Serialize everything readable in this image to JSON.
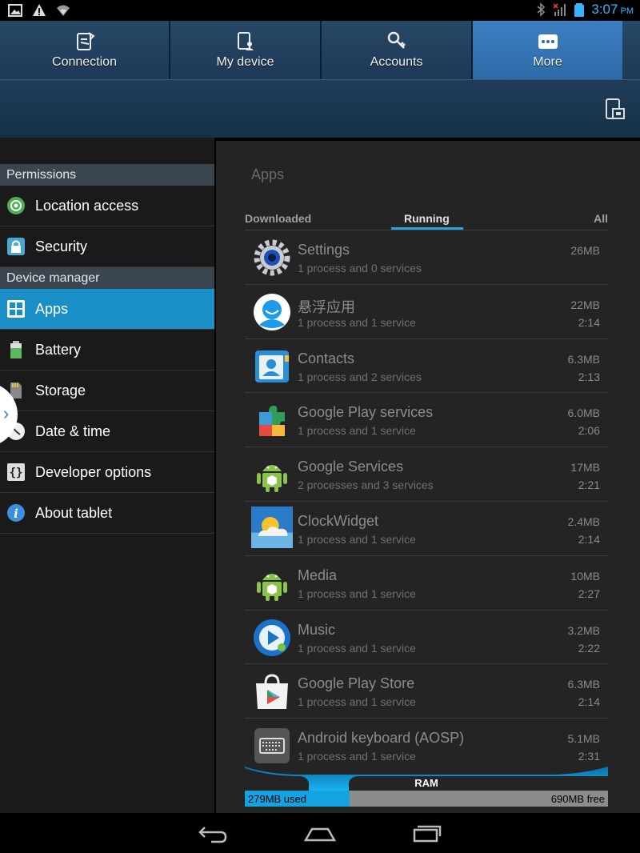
{
  "status": {
    "time": "3:07",
    "ampm": "PM"
  },
  "tabs": [
    {
      "label": "Connection",
      "icon": "connection-icon",
      "active": false
    },
    {
      "label": "My device",
      "icon": "device-icon",
      "active": false
    },
    {
      "label": "Accounts",
      "icon": "key-icon",
      "active": false
    },
    {
      "label": "More",
      "icon": "more-icon",
      "active": true
    }
  ],
  "sidebar": {
    "sections": [
      {
        "header": "Permissions",
        "items": [
          {
            "label": "Location access",
            "icon": "location-icon"
          },
          {
            "label": "Security",
            "icon": "lock-icon"
          }
        ]
      },
      {
        "header": "Device manager",
        "items": [
          {
            "label": "Apps",
            "icon": "apps-grid-icon",
            "active": true
          },
          {
            "label": "Battery",
            "icon": "battery-icon"
          },
          {
            "label": "Storage",
            "icon": "sd-card-icon"
          },
          {
            "label": "Date & time",
            "icon": "clock-icon"
          },
          {
            "label": "Developer options",
            "icon": "braces-icon"
          },
          {
            "label": "About tablet",
            "icon": "info-icon"
          }
        ]
      }
    ]
  },
  "main": {
    "title": "Apps",
    "subtabs": {
      "downloaded": "Downloaded",
      "running": "Running",
      "all": "All"
    },
    "apps": [
      {
        "name": "Settings",
        "detail": "1 process and 0 services",
        "size": "26MB",
        "time": ""
      },
      {
        "name": "悬浮应用",
        "detail": "1 process and 1 service",
        "size": "22MB",
        "time": "2:14"
      },
      {
        "name": "Contacts",
        "detail": "1 process and 2 services",
        "size": "6.3MB",
        "time": "2:13"
      },
      {
        "name": "Google Play services",
        "detail": "1 process and 1 service",
        "size": "6.0MB",
        "time": "2:06"
      },
      {
        "name": "Google Services",
        "detail": "2 processes and 3 services",
        "size": "17MB",
        "time": "2:21"
      },
      {
        "name": "ClockWidget",
        "detail": "1 process and 1 service",
        "size": "2.4MB",
        "time": "2:14"
      },
      {
        "name": "Media",
        "detail": "1 process and 1 service",
        "size": "10MB",
        "time": "2:27"
      },
      {
        "name": "Music",
        "detail": "1 process and 1 service",
        "size": "3.2MB",
        "time": "2:22"
      },
      {
        "name": "Google Play Store",
        "detail": "1 process and 1 service",
        "size": "6.3MB",
        "time": "2:14"
      },
      {
        "name": "Android keyboard (AOSP)",
        "detail": "1 process and 1 service",
        "size": "5.1MB",
        "time": "2:31"
      }
    ],
    "ram": {
      "label": "RAM",
      "used": "279MB used",
      "free": "690MB free",
      "used_fraction": 0.288
    }
  },
  "colors": {
    "accent": "#1a8ec6",
    "tab_active": "#3d7fc2",
    "ram_used": "#14a3e0"
  }
}
